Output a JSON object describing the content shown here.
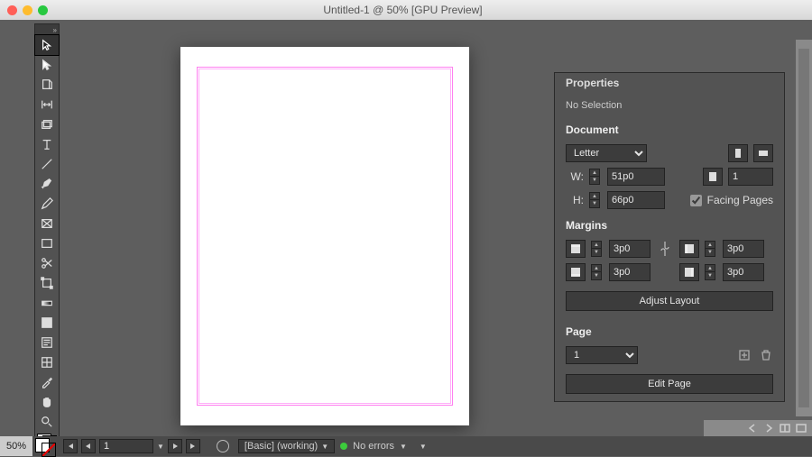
{
  "titlebar": {
    "title": "Untitled-1 @ 50% [GPU Preview]"
  },
  "tools": [
    "selection",
    "direct-selection",
    "page",
    "gap",
    "content-collector",
    "type",
    "line",
    "pen",
    "pencil",
    "rectangle-frame",
    "rectangle",
    "shear",
    "free-transform",
    "scissors",
    "gradient-swatch",
    "note",
    "color-theme",
    "eyedropper",
    "hand",
    "zoom"
  ],
  "properties": {
    "tab": "Properties",
    "selection_state": "No Selection",
    "document": {
      "header": "Document",
      "preset": "Letter",
      "width_label": "W:",
      "width": "51p0",
      "height_label": "H:",
      "height": "66p0",
      "pages": "1",
      "facing_pages_label": "Facing Pages",
      "facing_pages": true
    },
    "margins": {
      "header": "Margins",
      "top": "3p0",
      "bottom": "3p0",
      "left": "3p0",
      "right": "3p0",
      "button": "Adjust Layout"
    },
    "page": {
      "header": "Page",
      "current": "1",
      "button": "Edit Page"
    }
  },
  "status": {
    "zoom": "50%",
    "page": "1",
    "preflight_profile": "[Basic] (working)",
    "preflight_status": "No errors"
  }
}
